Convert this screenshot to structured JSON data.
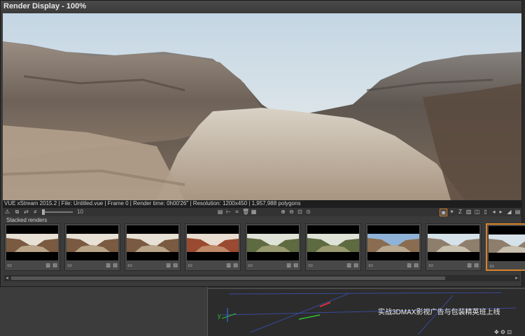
{
  "window": {
    "title": "Render Display - 100%"
  },
  "info_bar": {
    "text": "VUE xStream 2015.2 | File: Untitled.vue | Frame 0 | Render time: 0h00'26\" | Resolution: 1200x450 | 1,957,988 polygons"
  },
  "toolbar": {
    "zoom_value": "10",
    "left_icons": [
      "warning-icon",
      "copy-icon",
      "swap-icon",
      "compare-icon"
    ],
    "center_icons": [
      "stack-icon",
      "fit-icon",
      "crop-icon",
      "delete-icon",
      "save-icon"
    ],
    "zoom_icons": [
      "zoom-in-icon",
      "zoom-out-icon",
      "zoom-fit-icon",
      "zoom-reset-icon"
    ],
    "right_icons": [
      "display-icon",
      "star-icon",
      "z-icon",
      "channel-icon",
      "compare-icon",
      "split-icon",
      "prev-icon",
      "next-icon",
      "sep",
      "contrast-icon",
      "save-icon"
    ]
  },
  "stacked_renders": {
    "label": "Stacked renders",
    "thumbnails": [
      {
        "scene": "canyon-warm",
        "selected": false
      },
      {
        "scene": "canyon-warm",
        "selected": false
      },
      {
        "scene": "canyon-warm",
        "selected": false
      },
      {
        "scene": "canyon-red",
        "selected": false
      },
      {
        "scene": "canyon-green",
        "selected": false
      },
      {
        "scene": "canyon-green",
        "selected": false
      },
      {
        "scene": "canyon-sky",
        "selected": false
      },
      {
        "scene": "canyon-pale",
        "selected": false
      },
      {
        "scene": "canyon-pale",
        "selected": true
      }
    ]
  },
  "background_viewport": {
    "watermark": "实战3DMAX影视广告与包装精英班上线",
    "axis_label": "y"
  },
  "colors": {
    "accent": "#d8832a",
    "window_bg": "#3a3a3a",
    "info_bar_bg": "#1e1e1e"
  }
}
